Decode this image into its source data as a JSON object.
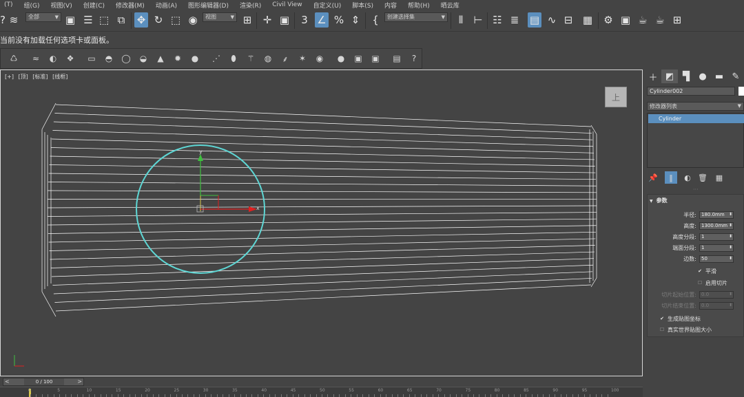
{
  "menubar": {
    "items": [
      "(T)",
      "组(G)",
      "视图(V)",
      "创建(C)",
      "修改器(M)",
      "动画(A)",
      "图形编辑器(D)",
      "渲染(R)",
      "Civil View",
      "自定义(U)",
      "脚本(S)",
      "内容",
      "帮助(H)",
      "晒云库"
    ]
  },
  "toolbar": {
    "selection_filter": "全部",
    "ref_coord": "视图",
    "named_selection": "创建选择集"
  },
  "status_message": "当前没有加载任何选项卡或面板。",
  "viewport": {
    "labels": [
      "[+]",
      "[顶]",
      "[标准]",
      "[线框]"
    ],
    "viewcube_label": "上",
    "colors": {
      "border": "#d8d8d8",
      "wire": "#ffffff",
      "selected_circle": "#5ed7d5",
      "gizmo_x": "#e02020",
      "gizmo_y": "#3fbf3f"
    }
  },
  "command_panel": {
    "tabs": [
      "create-icon",
      "modify-icon",
      "hierarchy-icon",
      "motion-icon",
      "display-icon",
      "utilities-icon"
    ],
    "object_name": "Cylinder002",
    "modifier_list": "修改器列表",
    "stack_item": "Cylinder",
    "rollout_title": "参数",
    "params": [
      {
        "label": "半径:",
        "value": "180.0mm",
        "enabled": true
      },
      {
        "label": "高度:",
        "value": "1300.0mm",
        "enabled": true
      },
      {
        "label": "高度分段:",
        "value": "1",
        "enabled": true
      },
      {
        "label": "端面分段:",
        "value": "1",
        "enabled": true
      },
      {
        "label": "边数:",
        "value": "50",
        "enabled": true
      }
    ],
    "smooth_label": "平滑",
    "slice_on_label": "启用切片",
    "slice_from": {
      "label": "切片起始位置:",
      "value": "0.0"
    },
    "slice_to": {
      "label": "切片结束位置:",
      "value": "0.0"
    },
    "gen_map_coords_label": "生成贴图坐标",
    "real_world_label": "真实世界贴图大小",
    "smooth_checked": true,
    "slice_on_checked": false,
    "gen_map_coords_checked": true,
    "real_world_checked": false
  },
  "timeline": {
    "frame_display": "0 / 100",
    "prev_label": "<",
    "next_label": ">",
    "ticks": [
      "0",
      "5",
      "10",
      "15",
      "20",
      "25",
      "30",
      "35",
      "40",
      "45",
      "50",
      "55",
      "60",
      "65",
      "70",
      "75",
      "80",
      "85",
      "90",
      "95",
      "100"
    ]
  }
}
